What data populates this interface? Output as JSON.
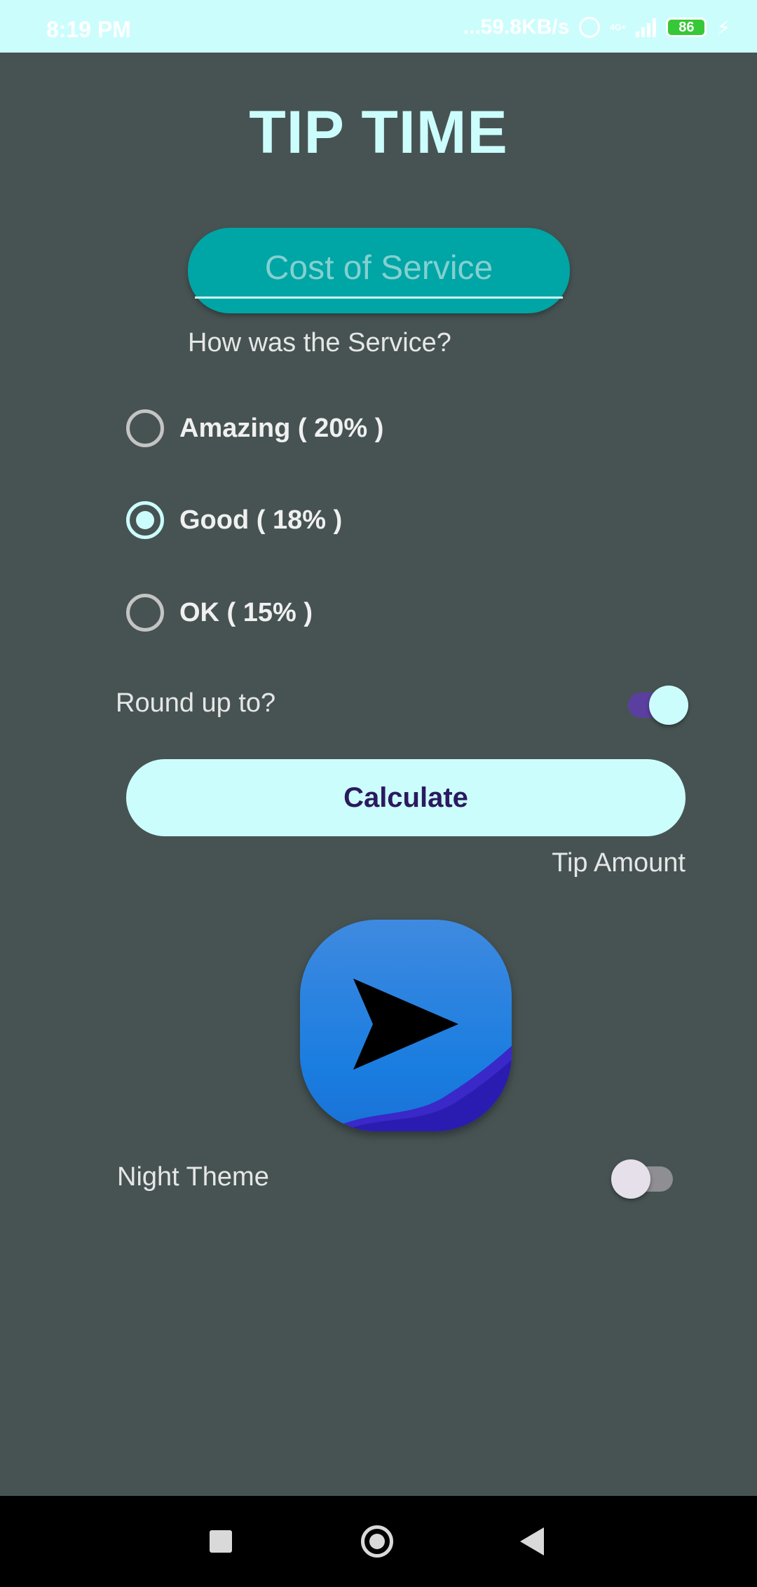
{
  "status_bar": {
    "time": "8:19 PM",
    "network_speed": "...59.8KB/s",
    "battery_level": "86",
    "network_type": "4G+"
  },
  "app": {
    "title": "TIP TIME"
  },
  "cost_field": {
    "placeholder": "Cost of Service"
  },
  "service": {
    "question": "How was the Service?",
    "options": [
      {
        "label": "Amazing ( 20% )",
        "checked": false
      },
      {
        "label": "Good ( 18% )",
        "checked": true
      },
      {
        "label": "OK ( 15% )",
        "checked": false
      }
    ]
  },
  "round_up": {
    "label": "Round up to?",
    "enabled": true
  },
  "calculate_button": {
    "label": "Calculate"
  },
  "tip_amount": {
    "label": "Tip Amount"
  },
  "night_theme": {
    "label": "Night Theme",
    "enabled": false
  },
  "colors": {
    "background": "#475353",
    "accent": "#ccfdfd",
    "field": "#00a5a5",
    "button_text": "#2a1a5e",
    "switch_track_on": "#5b3fa0"
  }
}
